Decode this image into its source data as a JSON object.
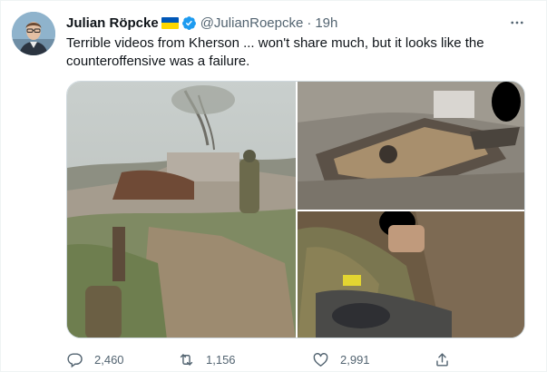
{
  "tweet": {
    "author": {
      "name": "Julian Röpcke",
      "flag_colors": [
        "#0057b7",
        "#ffd700"
      ],
      "verified_icon": "verified-badge-icon",
      "handle": "@JulianRoepcke",
      "separator": "·",
      "time": "19h"
    },
    "more_icon": "more-horizontal-icon",
    "text_lines": [
      "Terrible videos from Kherson ... won't share much, but it looks like the",
      "counteroffensive was a failure."
    ],
    "media": [
      {
        "icon": "photo-soldiers-field"
      },
      {
        "icon": "photo-destroyed-vehicle"
      },
      {
        "icon": "photo-soldiers-closeup"
      }
    ],
    "actions": {
      "reply": {
        "icon": "reply-icon",
        "count": "2,460"
      },
      "retweet": {
        "icon": "retweet-icon",
        "count": "1,156"
      },
      "like": {
        "icon": "heart-icon",
        "count": "2,991"
      },
      "share": {
        "icon": "share-icon"
      }
    },
    "colors": {
      "text": "#0f1419",
      "secondary": "#536471",
      "verified": "#1d9bf0",
      "border": "#cfd9de"
    }
  }
}
